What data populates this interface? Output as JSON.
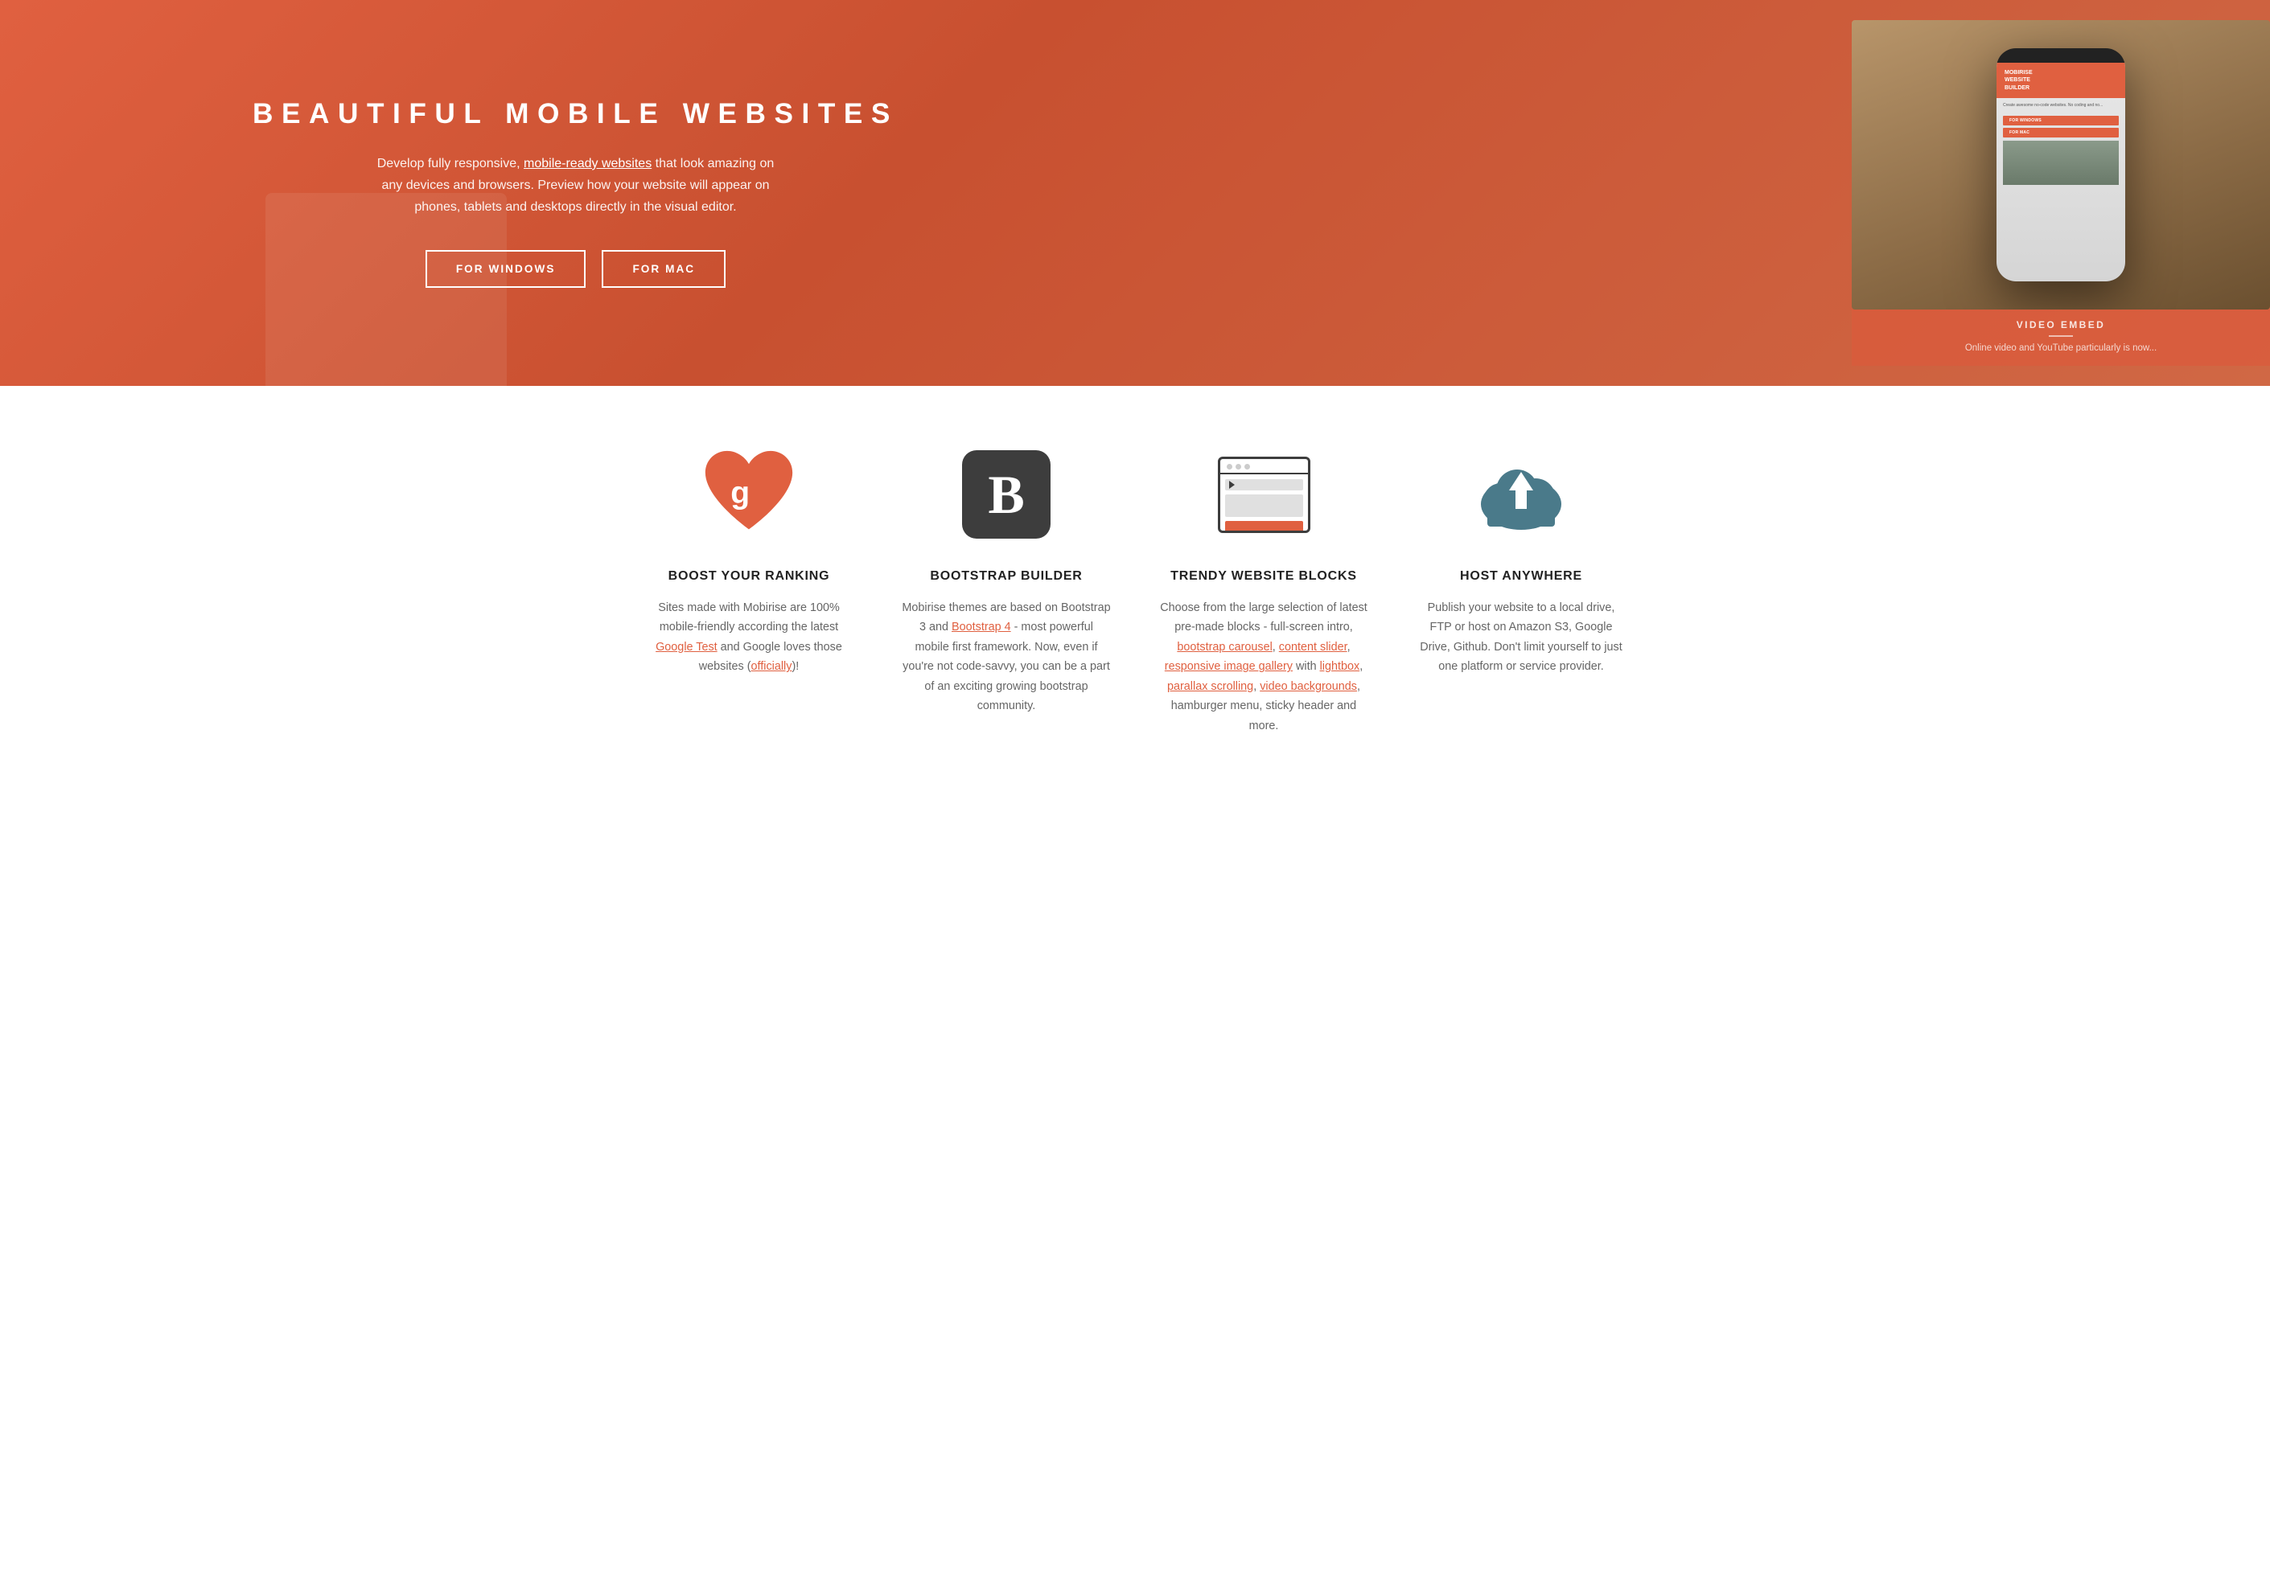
{
  "hero": {
    "title": "BEAUTIFUL MOBILE WEBSITES",
    "description_part1": "Develop fully responsive, ",
    "description_link": "mobile-ready websites",
    "description_part2": " that look amazing on any devices and browsers. Preview how your website will appear on phones, tablets and desktops directly in the visual editor.",
    "button_windows": "FOR WINDOWS",
    "button_mac": "FOR MAC",
    "phone_header_line1": "MOBIRISE",
    "phone_header_line2": "WEBSITE",
    "phone_header_line3": "BUILDER",
    "phone_body": "Create awesome no-code websites. No coding and no...",
    "phone_btn_windows": "FOR WINDOWS",
    "phone_btn_mac": "FOR MAC",
    "video_label": "VIDEO EMBED",
    "video_desc": "Online video and YouTube particularly is now..."
  },
  "features": [
    {
      "id": "boost-ranking",
      "title": "BOOST YOUR RANKING",
      "desc_plain": "Sites made with Mobirise are 100% mobile-friendly according the latest ",
      "desc_link1": "Google Test",
      "desc_middle": " and Google loves those websites (",
      "desc_link2": "officially",
      "desc_end": ")!",
      "icon": "heart-google"
    },
    {
      "id": "bootstrap-builder",
      "title": "BOOTSTRAP BUILDER",
      "desc_plain": "Mobirise themes are based on Bootstrap 3 and ",
      "desc_link1": "Bootstrap 4",
      "desc_middle": " - most powerful mobile first framework. Now, even if you're not code-savvy, you can be a part of an exciting growing bootstrap community.",
      "icon": "bootstrap-b"
    },
    {
      "id": "trendy-blocks",
      "title": "TRENDY WEBSITE BLOCKS",
      "desc_plain": "Choose from the large selection of latest pre-made blocks - full-screen intro, ",
      "desc_link1": "bootstrap carousel",
      "desc_comma1": ", ",
      "desc_link2": "content slider",
      "desc_comma2": ", ",
      "desc_link3": "responsive image gallery",
      "desc_mid2": " with ",
      "desc_link4": "lightbox",
      "desc_comma3": ", ",
      "desc_link5": "parallax scrolling",
      "desc_comma4": ", ",
      "desc_link6": "video backgrounds",
      "desc_end": ", hamburger menu, sticky header and more.",
      "icon": "browser-blocks"
    },
    {
      "id": "host-anywhere",
      "title": "HOST ANYWHERE",
      "desc_plain": "Publish your website to a local drive, FTP or host on Amazon S3, Google Drive, Github. Don't limit yourself to just one platform or service provider.",
      "icon": "cloud-upload"
    }
  ],
  "colors": {
    "primary": "#e06040",
    "dark": "#3d3d3d",
    "text": "#666666",
    "title": "#222222",
    "cloud": "#4a7a8a",
    "heart": "#e06040",
    "white": "#ffffff"
  }
}
